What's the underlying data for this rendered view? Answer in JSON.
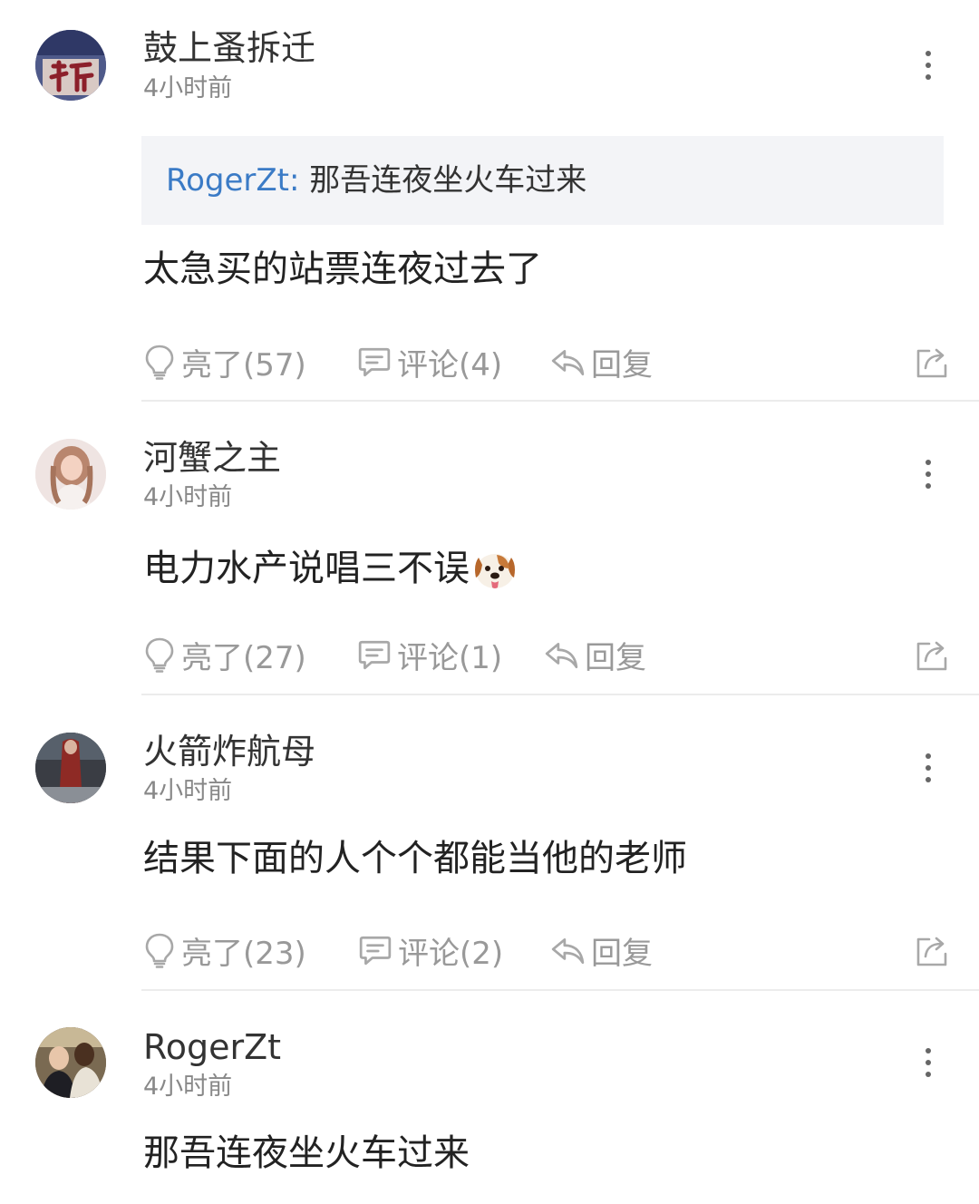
{
  "actions": {
    "like_prefix": "亮了",
    "comment_prefix": "评论",
    "reply": "回复"
  },
  "comments": [
    {
      "username": "鼓上蚤拆迁",
      "time": "4小时前",
      "quote": {
        "user": "RogerZt:",
        "text": " 那吾连夜坐火车过来"
      },
      "content": "太急买的站票连夜过去了",
      "likes": "亮了(57)",
      "comments": "评论(4)",
      "reply": "回复"
    },
    {
      "username": "河蟹之主",
      "time": "4小时前",
      "content": "电力水产说唱三不误",
      "emoji": "dog-face",
      "likes": "亮了(27)",
      "comments": "评论(1)",
      "reply": "回复"
    },
    {
      "username": "火箭炸航母",
      "time": "4小时前",
      "content": "结果下面的人个个都能当他的老师",
      "likes": "亮了(23)",
      "comments": "评论(2)",
      "reply": "回复"
    },
    {
      "username": "RogerZt",
      "time": "4小时前",
      "content": "那吾连夜坐火车过来"
    }
  ],
  "colors": {
    "link_blue": "#3b7bc6",
    "quote_bg": "#f3f4f7",
    "muted": "#999999"
  }
}
